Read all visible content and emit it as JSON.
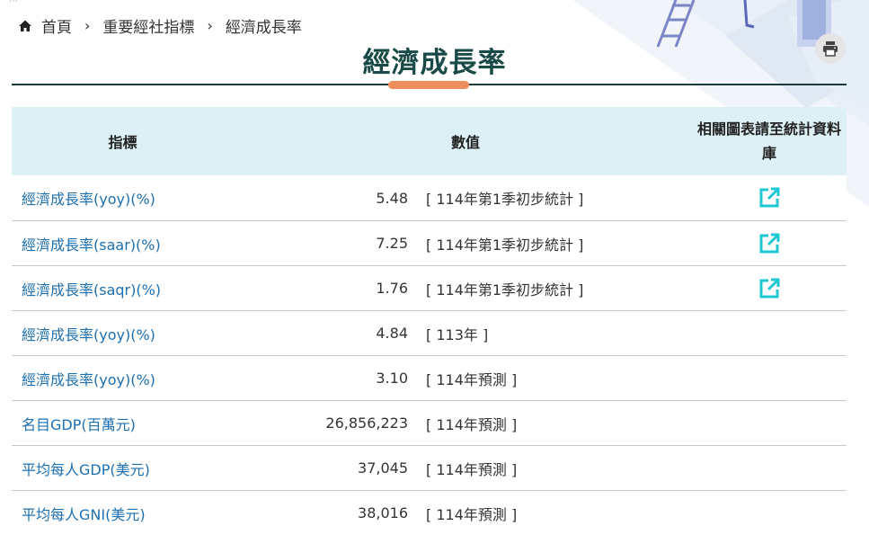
{
  "breadcrumb": {
    "home": "首頁",
    "level2": "重要經社指標",
    "current": "經濟成長率"
  },
  "page_title": "經濟成長率",
  "table": {
    "headers": {
      "indicator": "指標",
      "value": "數值",
      "chart_link": "相關圖表請至統計資料庫"
    },
    "rows": [
      {
        "name": "經濟成長率(yoy)(%)",
        "value": "5.48",
        "note": "[ 114年第1季初步統計 ]",
        "has_link": true
      },
      {
        "name": "經濟成長率(saar)(%)",
        "value": "7.25",
        "note": "[ 114年第1季初步統計 ]",
        "has_link": true
      },
      {
        "name": "經濟成長率(saqr)(%)",
        "value": "1.76",
        "note": "[ 114年第1季初步統計 ]",
        "has_link": true
      },
      {
        "name": "經濟成長率(yoy)(%)",
        "value": "4.84",
        "note": "[ 113年 ]",
        "has_link": false
      },
      {
        "name": "經濟成長率(yoy)(%)",
        "value": "3.10",
        "note": "[ 114年預測 ]",
        "has_link": false
      },
      {
        "name": "名目GDP(百萬元)",
        "value": "26,856,223",
        "note": "[ 114年預測 ]",
        "has_link": false
      },
      {
        "name": "平均每人GDP(美元)",
        "value": "37,045",
        "note": "[ 114年預測 ]",
        "has_link": false
      },
      {
        "name": "平均每人GNI(美元)",
        "value": "38,016",
        "note": "[ 114年預測 ]",
        "has_link": false
      }
    ]
  },
  "icons": {
    "home": "home-icon",
    "separator": "chevron-right-icon",
    "print": "printer-icon",
    "external": "external-link-icon"
  },
  "colors": {
    "title": "#1a4a47",
    "accent": "#ef8e5d",
    "header_bg": "#dcf0f5",
    "link": "#1d6fb0",
    "external_icon": "#1ec8d2"
  }
}
